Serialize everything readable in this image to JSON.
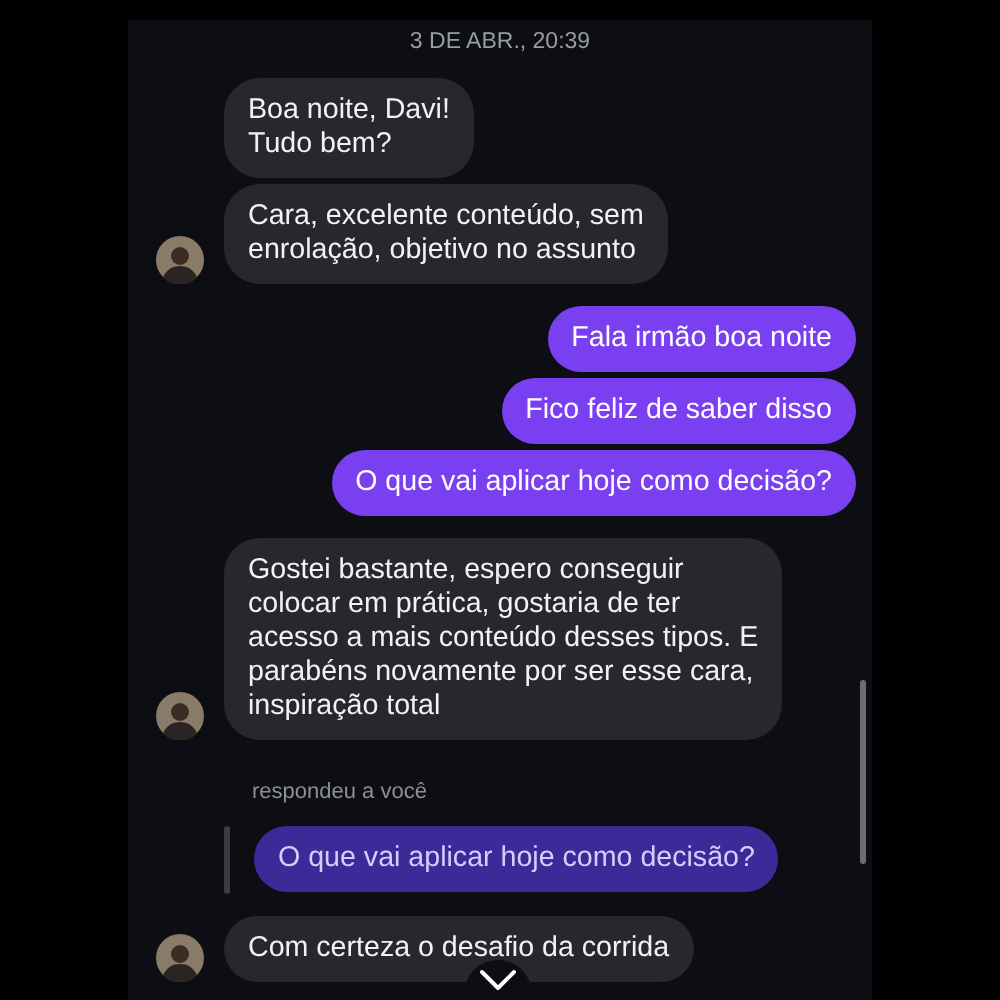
{
  "date": "3 DE ABR., 20:39",
  "messages": [
    {
      "kind": "incoming",
      "text": "Boa noite, Davi!\nTudo bem?",
      "avatar": false
    },
    {
      "kind": "incoming",
      "text": "Cara, excelente conteúdo, sem\nenrolação, objetivo no assunto",
      "avatar": true
    },
    {
      "kind": "outgoing",
      "text": "Fala irmão boa noite"
    },
    {
      "kind": "outgoing",
      "text": "Fico feliz de saber disso"
    },
    {
      "kind": "outgoing",
      "text": "O que vai aplicar hoje como decisão?"
    },
    {
      "kind": "incoming",
      "text": "Gostei bastante, espero conseguir\ncolocar em prática, gostaria de ter\nacesso a mais conteúdo desses tipos. E\nparabéns novamente por ser esse cara,\ninspiração total",
      "avatar": true
    },
    {
      "kind": "reply-label",
      "text": "respondeu a você"
    },
    {
      "kind": "quoted",
      "text": "O que vai aplicar hoje como decisão?"
    },
    {
      "kind": "incoming",
      "text": "Com certeza o desafio da corrida",
      "avatar": true
    }
  ]
}
